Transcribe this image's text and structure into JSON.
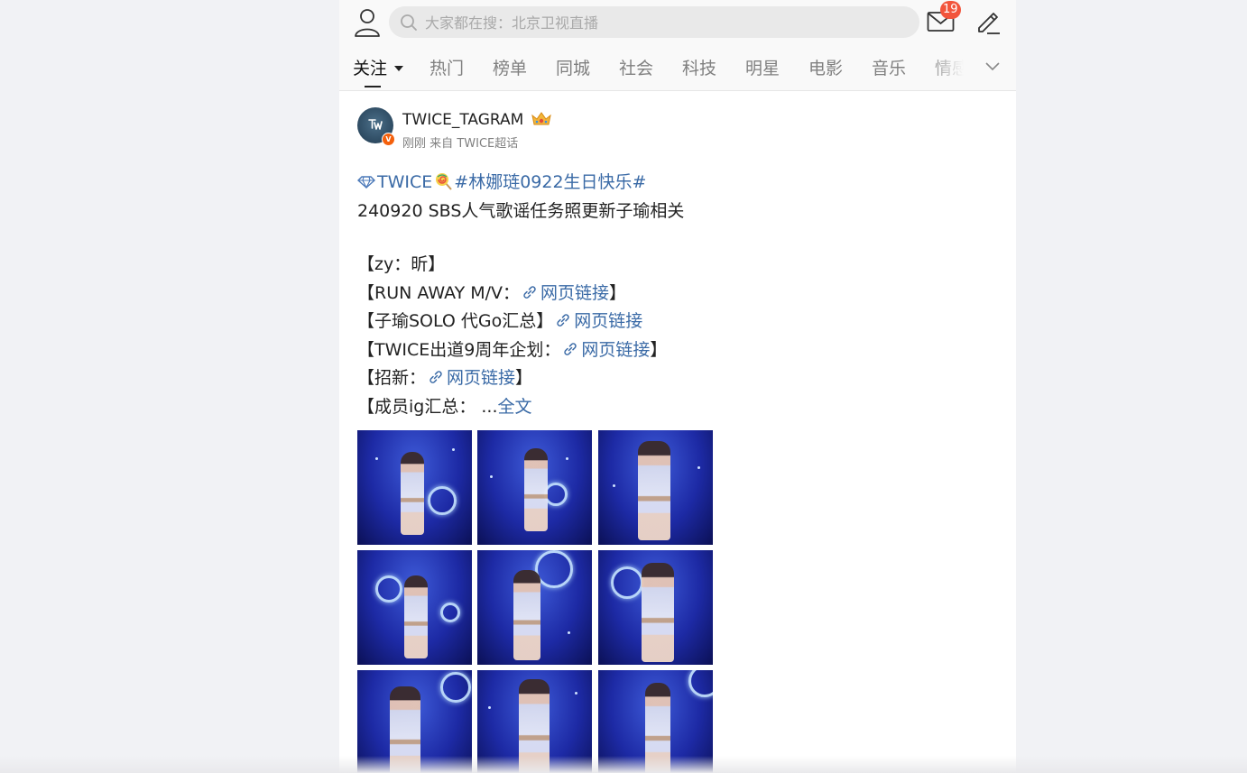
{
  "header": {
    "search_placeholder": "大家都在搜：北京卫视直播",
    "mail_badge": "19"
  },
  "tabs": [
    {
      "label": "关注",
      "active": true
    },
    {
      "label": "热门"
    },
    {
      "label": "榜单"
    },
    {
      "label": "同城"
    },
    {
      "label": "社会"
    },
    {
      "label": "科技"
    },
    {
      "label": "明星"
    },
    {
      "label": "电影"
    },
    {
      "label": "音乐"
    },
    {
      "label": "情感"
    }
  ],
  "post": {
    "username": "TWICE_TAGRAM",
    "time": "刚刚",
    "from_prefix": "来自",
    "source": "TWICE超话",
    "line1": {
      "topic": "TWICE",
      "hashtag": "#林娜琏0922生日快乐#"
    },
    "line2": "240920 SBS人气歌谣任务照更新子瑜相关",
    "line3": "【zy：昕】",
    "line4": {
      "pre": "【RUN AWAY M/V：",
      "link": "网页链接",
      "post": "】"
    },
    "line5": {
      "pre": "【子瑜SOLO 代Go汇总】",
      "link": "网页链接"
    },
    "line6": {
      "pre": "【TWICE出道9周年企划：",
      "link": "网页链接",
      "post": "】"
    },
    "line7": {
      "pre": "【招新：",
      "link": "网页链接",
      "post": "】"
    },
    "line8": {
      "pre": "【成员ig汇总：  ...",
      "more": "全文"
    }
  },
  "colors": {
    "link": "#3a6aa6",
    "badge": "#f2553c",
    "verified": "#f4600c"
  },
  "icons": [
    "user-icon",
    "search-icon",
    "mail-icon",
    "edit-icon",
    "chevron-down-icon",
    "diamond-icon",
    "lollipop-icon",
    "link-icon",
    "crown-icon"
  ]
}
